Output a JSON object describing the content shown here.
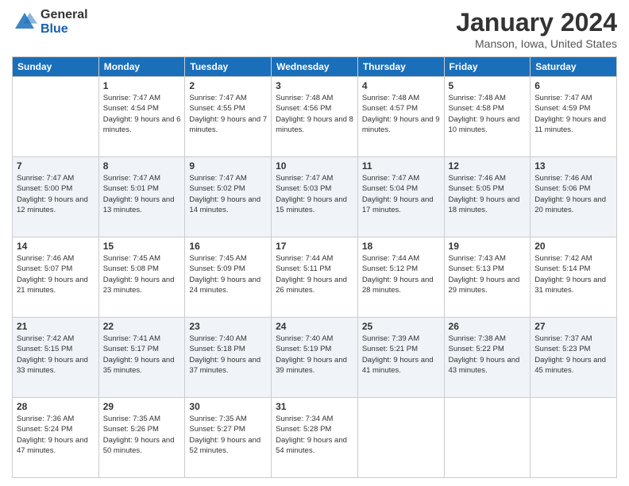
{
  "header": {
    "logo_general": "General",
    "logo_blue": "Blue",
    "month_title": "January 2024",
    "location": "Manson, Iowa, United States"
  },
  "days_of_week": [
    "Sunday",
    "Monday",
    "Tuesday",
    "Wednesday",
    "Thursday",
    "Friday",
    "Saturday"
  ],
  "weeks": [
    [
      {
        "day": "",
        "sunrise": "",
        "sunset": "",
        "daylight": ""
      },
      {
        "day": "1",
        "sunrise": "Sunrise: 7:47 AM",
        "sunset": "Sunset: 4:54 PM",
        "daylight": "Daylight: 9 hours and 6 minutes."
      },
      {
        "day": "2",
        "sunrise": "Sunrise: 7:47 AM",
        "sunset": "Sunset: 4:55 PM",
        "daylight": "Daylight: 9 hours and 7 minutes."
      },
      {
        "day": "3",
        "sunrise": "Sunrise: 7:48 AM",
        "sunset": "Sunset: 4:56 PM",
        "daylight": "Daylight: 9 hours and 8 minutes."
      },
      {
        "day": "4",
        "sunrise": "Sunrise: 7:48 AM",
        "sunset": "Sunset: 4:57 PM",
        "daylight": "Daylight: 9 hours and 9 minutes."
      },
      {
        "day": "5",
        "sunrise": "Sunrise: 7:48 AM",
        "sunset": "Sunset: 4:58 PM",
        "daylight": "Daylight: 9 hours and 10 minutes."
      },
      {
        "day": "6",
        "sunrise": "Sunrise: 7:47 AM",
        "sunset": "Sunset: 4:59 PM",
        "daylight": "Daylight: 9 hours and 11 minutes."
      }
    ],
    [
      {
        "day": "7",
        "sunrise": "Sunrise: 7:47 AM",
        "sunset": "Sunset: 5:00 PM",
        "daylight": "Daylight: 9 hours and 12 minutes."
      },
      {
        "day": "8",
        "sunrise": "Sunrise: 7:47 AM",
        "sunset": "Sunset: 5:01 PM",
        "daylight": "Daylight: 9 hours and 13 minutes."
      },
      {
        "day": "9",
        "sunrise": "Sunrise: 7:47 AM",
        "sunset": "Sunset: 5:02 PM",
        "daylight": "Daylight: 9 hours and 14 minutes."
      },
      {
        "day": "10",
        "sunrise": "Sunrise: 7:47 AM",
        "sunset": "Sunset: 5:03 PM",
        "daylight": "Daylight: 9 hours and 15 minutes."
      },
      {
        "day": "11",
        "sunrise": "Sunrise: 7:47 AM",
        "sunset": "Sunset: 5:04 PM",
        "daylight": "Daylight: 9 hours and 17 minutes."
      },
      {
        "day": "12",
        "sunrise": "Sunrise: 7:46 AM",
        "sunset": "Sunset: 5:05 PM",
        "daylight": "Daylight: 9 hours and 18 minutes."
      },
      {
        "day": "13",
        "sunrise": "Sunrise: 7:46 AM",
        "sunset": "Sunset: 5:06 PM",
        "daylight": "Daylight: 9 hours and 20 minutes."
      }
    ],
    [
      {
        "day": "14",
        "sunrise": "Sunrise: 7:46 AM",
        "sunset": "Sunset: 5:07 PM",
        "daylight": "Daylight: 9 hours and 21 minutes."
      },
      {
        "day": "15",
        "sunrise": "Sunrise: 7:45 AM",
        "sunset": "Sunset: 5:08 PM",
        "daylight": "Daylight: 9 hours and 23 minutes."
      },
      {
        "day": "16",
        "sunrise": "Sunrise: 7:45 AM",
        "sunset": "Sunset: 5:09 PM",
        "daylight": "Daylight: 9 hours and 24 minutes."
      },
      {
        "day": "17",
        "sunrise": "Sunrise: 7:44 AM",
        "sunset": "Sunset: 5:11 PM",
        "daylight": "Daylight: 9 hours and 26 minutes."
      },
      {
        "day": "18",
        "sunrise": "Sunrise: 7:44 AM",
        "sunset": "Sunset: 5:12 PM",
        "daylight": "Daylight: 9 hours and 28 minutes."
      },
      {
        "day": "19",
        "sunrise": "Sunrise: 7:43 AM",
        "sunset": "Sunset: 5:13 PM",
        "daylight": "Daylight: 9 hours and 29 minutes."
      },
      {
        "day": "20",
        "sunrise": "Sunrise: 7:42 AM",
        "sunset": "Sunset: 5:14 PM",
        "daylight": "Daylight: 9 hours and 31 minutes."
      }
    ],
    [
      {
        "day": "21",
        "sunrise": "Sunrise: 7:42 AM",
        "sunset": "Sunset: 5:15 PM",
        "daylight": "Daylight: 9 hours and 33 minutes."
      },
      {
        "day": "22",
        "sunrise": "Sunrise: 7:41 AM",
        "sunset": "Sunset: 5:17 PM",
        "daylight": "Daylight: 9 hours and 35 minutes."
      },
      {
        "day": "23",
        "sunrise": "Sunrise: 7:40 AM",
        "sunset": "Sunset: 5:18 PM",
        "daylight": "Daylight: 9 hours and 37 minutes."
      },
      {
        "day": "24",
        "sunrise": "Sunrise: 7:40 AM",
        "sunset": "Sunset: 5:19 PM",
        "daylight": "Daylight: 9 hours and 39 minutes."
      },
      {
        "day": "25",
        "sunrise": "Sunrise: 7:39 AM",
        "sunset": "Sunset: 5:21 PM",
        "daylight": "Daylight: 9 hours and 41 minutes."
      },
      {
        "day": "26",
        "sunrise": "Sunrise: 7:38 AM",
        "sunset": "Sunset: 5:22 PM",
        "daylight": "Daylight: 9 hours and 43 minutes."
      },
      {
        "day": "27",
        "sunrise": "Sunrise: 7:37 AM",
        "sunset": "Sunset: 5:23 PM",
        "daylight": "Daylight: 9 hours and 45 minutes."
      }
    ],
    [
      {
        "day": "28",
        "sunrise": "Sunrise: 7:36 AM",
        "sunset": "Sunset: 5:24 PM",
        "daylight": "Daylight: 9 hours and 47 minutes."
      },
      {
        "day": "29",
        "sunrise": "Sunrise: 7:35 AM",
        "sunset": "Sunset: 5:26 PM",
        "daylight": "Daylight: 9 hours and 50 minutes."
      },
      {
        "day": "30",
        "sunrise": "Sunrise: 7:35 AM",
        "sunset": "Sunset: 5:27 PM",
        "daylight": "Daylight: 9 hours and 52 minutes."
      },
      {
        "day": "31",
        "sunrise": "Sunrise: 7:34 AM",
        "sunset": "Sunset: 5:28 PM",
        "daylight": "Daylight: 9 hours and 54 minutes."
      },
      {
        "day": "",
        "sunrise": "",
        "sunset": "",
        "daylight": ""
      },
      {
        "day": "",
        "sunrise": "",
        "sunset": "",
        "daylight": ""
      },
      {
        "day": "",
        "sunrise": "",
        "sunset": "",
        "daylight": ""
      }
    ]
  ]
}
